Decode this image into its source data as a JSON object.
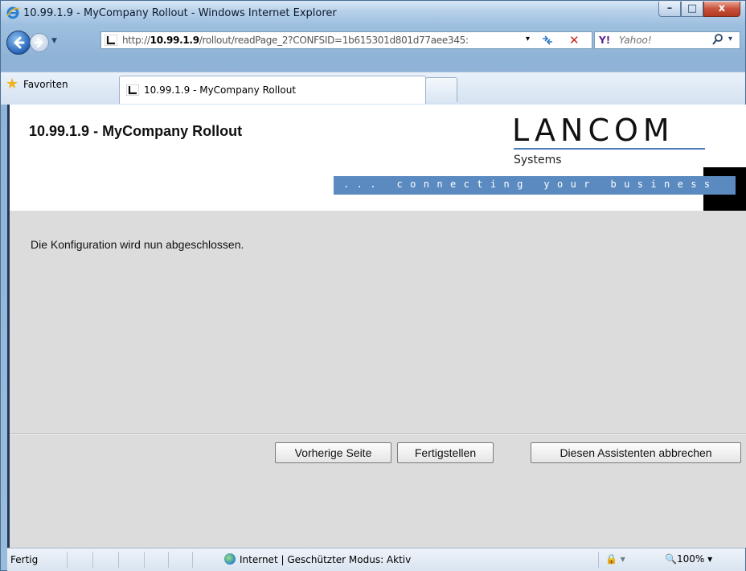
{
  "window": {
    "title": "10.99.1.9 - MyCompany Rollout - Windows Internet Explorer",
    "minimize_glyph": "–",
    "maximize_glyph": "□",
    "close_glyph": "x"
  },
  "addressbar": {
    "url_prefix": "http://",
    "url_host": "10.99.1.9",
    "url_path": "/rollout/readPage_2?CONFSID=1b615301d801d77aee345:",
    "dropdown_glyph": "▾",
    "refresh_glyph": "⁴⁄",
    "stop_glyph": "✕"
  },
  "search": {
    "brand": "Y!",
    "placeholder": "Yahoo!",
    "search_glyph": "⌕",
    "dropdown_glyph": "▾"
  },
  "tabs": {
    "favorites_label": "Favoriten",
    "active_tab_label": "10.99.1.9 - MyCompany Rollout"
  },
  "page": {
    "title": "10.99.1.9 - MyCompany Rollout",
    "logo_word": "LANCOM",
    "logo_sub": "Systems",
    "tagline": "... connecting your business",
    "message": "Die Konfiguration wird nun abgeschlossen.",
    "buttons": {
      "previous": "Vorherige Seite",
      "finish": "Fertigstellen",
      "cancel": "Diesen Assistenten abbrechen"
    }
  },
  "statusbar": {
    "status": "Fertig",
    "zone": "Internet | Geschützter Modus: Aktiv",
    "zoom": "100%",
    "zoom_icon": "🔍"
  },
  "colors": {
    "accent_blue": "#5a8ac0",
    "logo_line": "#4d7fb8",
    "content_bg": "#dcdcdc"
  }
}
